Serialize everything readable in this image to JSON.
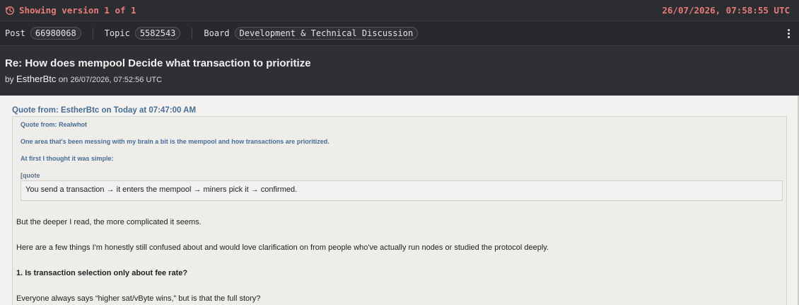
{
  "topbar": {
    "version_text": "Showing version 1 of 1",
    "timestamp": "26/07/2026, 07:58:55 UTC",
    "icon": "history-icon",
    "accent": "#e87a7a"
  },
  "meta": {
    "post_label": "Post",
    "post_id": "66980068",
    "topic_label": "Topic",
    "topic_id": "5582543",
    "board_label": "Board",
    "board_name": "Development & Technical Discussion",
    "menu_icon": "kebab-menu-icon"
  },
  "post": {
    "title": "Re: How does mempool Decide what transaction to prioritize",
    "by_label": "by",
    "author": "EstherBtc",
    "on_label": "on",
    "time": "26/07/2026, 07:52:56 UTC"
  },
  "body": {
    "outer_quote_header": "Quote from: EstherBtc on Today at 07:47:00 AM",
    "inner_quote_header": "Quote from: Realwhot",
    "quote_line1": "One area that's been messing with my brain a bit is the mempool and how transactions are prioritized.",
    "quote_line2": "At first I thought it was simple:",
    "quote_line3": "[quote",
    "quote_box": "You send a transaction → it enters the mempool → miners pick it → confirmed.",
    "para1": "But the deeper I read, the more complicated it seems.",
    "para2": "Here are a few things I'm honestly still confused about and would love clarification on from people who've actually run nodes or studied the protocol deeply.",
    "para3": "1. Is transaction selection only about fee rate?",
    "para4": "Everyone always says “higher sat/vByte wins,” but is that the full story?"
  }
}
